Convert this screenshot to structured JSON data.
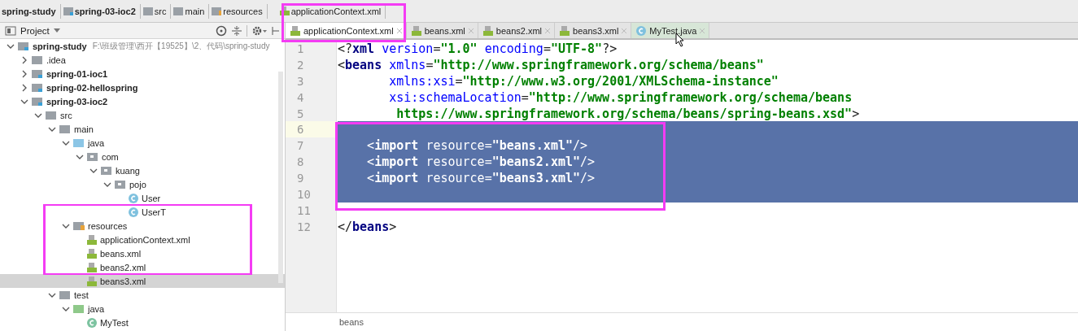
{
  "breadcrumbs": [
    {
      "label": "spring-study",
      "kind": "project"
    },
    {
      "label": "spring-03-ioc2",
      "kind": "module"
    },
    {
      "label": "src",
      "kind": "folder"
    },
    {
      "label": "main",
      "kind": "folder"
    },
    {
      "label": "resources",
      "kind": "resources"
    },
    {
      "label": "applicationContext.xml",
      "kind": "xml"
    }
  ],
  "project_panel": {
    "title": "Project",
    "tree": [
      {
        "label": "spring-study",
        "kind": "module",
        "path": "F:\\班级管理\\西开【19525】\\2、代码\\spring-study",
        "expanded": true,
        "selected": false,
        "children": [
          {
            "label": ".idea",
            "kind": "folder",
            "expanded": false,
            "selected": false
          },
          {
            "label": "spring-01-ioc1",
            "kind": "module",
            "expanded": false,
            "selected": false
          },
          {
            "label": "spring-02-hellospring",
            "kind": "module",
            "expanded": false,
            "selected": false
          },
          {
            "label": "spring-03-ioc2",
            "kind": "module",
            "expanded": true,
            "selected": false,
            "children": [
              {
                "label": "src",
                "kind": "folder",
                "expanded": true,
                "selected": false,
                "children": [
                  {
                    "label": "main",
                    "kind": "folder",
                    "expanded": true,
                    "selected": false,
                    "children": [
                      {
                        "label": "java",
                        "kind": "source",
                        "expanded": true,
                        "selected": false,
                        "children": [
                          {
                            "label": "com",
                            "kind": "package",
                            "expanded": true,
                            "selected": false,
                            "children": [
                              {
                                "label": "kuang",
                                "kind": "package",
                                "expanded": true,
                                "selected": false,
                                "children": [
                                  {
                                    "label": "pojo",
                                    "kind": "package",
                                    "expanded": true,
                                    "selected": false,
                                    "children": [
                                      {
                                        "label": "User",
                                        "kind": "class",
                                        "selected": false
                                      },
                                      {
                                        "label": "UserT",
                                        "kind": "class",
                                        "selected": false
                                      }
                                    ]
                                  }
                                ]
                              }
                            ]
                          }
                        ]
                      },
                      {
                        "label": "resources",
                        "kind": "resources",
                        "expanded": true,
                        "selected": false,
                        "children": [
                          {
                            "label": "applicationContext.xml",
                            "kind": "xml",
                            "selected": false
                          },
                          {
                            "label": "beans.xml",
                            "kind": "xml",
                            "selected": false
                          },
                          {
                            "label": "beans2.xml",
                            "kind": "xml",
                            "selected": false
                          },
                          {
                            "label": "beans3.xml",
                            "kind": "xml",
                            "selected": true
                          }
                        ]
                      }
                    ]
                  },
                  {
                    "label": "test",
                    "kind": "folder",
                    "expanded": true,
                    "selected": false,
                    "children": [
                      {
                        "label": "java",
                        "kind": "test",
                        "expanded": true,
                        "selected": false,
                        "children": [
                          {
                            "label": "MyTest",
                            "kind": "testclass",
                            "selected": false
                          }
                        ]
                      }
                    ]
                  }
                ]
              }
            ]
          }
        ]
      }
    ]
  },
  "tabs": [
    {
      "label": "applicationContext.xml",
      "kind": "xml",
      "selected": true
    },
    {
      "label": "beans.xml",
      "kind": "xml",
      "selected": false
    },
    {
      "label": "beans2.xml",
      "kind": "xml",
      "selected": false
    },
    {
      "label": "beans3.xml",
      "kind": "xml",
      "selected": false
    },
    {
      "label": "MyTest.java",
      "kind": "class",
      "selected": false
    }
  ],
  "editor": {
    "lines": [
      {
        "number": "1",
        "selected": false,
        "tokens": [
          {
            "kind": "punct",
            "text": "<?"
          },
          {
            "kind": "tag",
            "text": "xml "
          },
          {
            "kind": "attr",
            "text": "version"
          },
          {
            "kind": "punct",
            "text": "="
          },
          {
            "kind": "str",
            "text": "\"1.0\" "
          },
          {
            "kind": "attr",
            "text": "encoding"
          },
          {
            "kind": "punct",
            "text": "="
          },
          {
            "kind": "str",
            "text": "\"UTF-8\""
          },
          {
            "kind": "punct",
            "text": "?>"
          }
        ]
      },
      {
        "number": "2",
        "selected": false,
        "tokens": [
          {
            "kind": "punct",
            "text": "<"
          },
          {
            "kind": "tag",
            "text": "beans "
          },
          {
            "kind": "attr",
            "text": "xmlns"
          },
          {
            "kind": "punct",
            "text": "="
          },
          {
            "kind": "str",
            "text": "\"http://www.springframework.org/schema/beans\""
          }
        ]
      },
      {
        "number": "3",
        "selected": false,
        "tokens": [
          {
            "kind": "attr",
            "text": "       xmlns:xsi"
          },
          {
            "kind": "punct",
            "text": "="
          },
          {
            "kind": "str",
            "text": "\"http://www.w3.org/2001/XMLSchema-instance\""
          }
        ]
      },
      {
        "number": "4",
        "selected": false,
        "tokens": [
          {
            "kind": "attr",
            "text": "       xsi:schemaLocation"
          },
          {
            "kind": "punct",
            "text": "="
          },
          {
            "kind": "str",
            "text": "\"http://www.springframework.org/schema/beans"
          }
        ]
      },
      {
        "number": "5",
        "selected": false,
        "tokens": [
          {
            "kind": "str",
            "text": "        https://www.springframework.org/schema/beans/spring-beans.xsd\""
          },
          {
            "kind": "punct",
            "text": ">"
          }
        ]
      },
      {
        "number": "6",
        "selected": true
      },
      {
        "number": "7",
        "selected": true,
        "tokens": [
          {
            "kind": "punct",
            "text": "    <"
          },
          {
            "kind": "tag",
            "text": "import "
          },
          {
            "kind": "attr",
            "text": "resource"
          },
          {
            "kind": "punct",
            "text": "="
          },
          {
            "kind": "str",
            "text": "\"beans.xml\""
          },
          {
            "kind": "punct",
            "text": "/>"
          }
        ]
      },
      {
        "number": "8",
        "selected": true,
        "tokens": [
          {
            "kind": "punct",
            "text": "    <"
          },
          {
            "kind": "tag",
            "text": "import "
          },
          {
            "kind": "attr",
            "text": "resource"
          },
          {
            "kind": "punct",
            "text": "="
          },
          {
            "kind": "str",
            "text": "\"beans2.xml\""
          },
          {
            "kind": "punct",
            "text": "/>"
          }
        ]
      },
      {
        "number": "9",
        "selected": true,
        "tokens": [
          {
            "kind": "punct",
            "text": "    <"
          },
          {
            "kind": "tag",
            "text": "import "
          },
          {
            "kind": "attr",
            "text": "resource"
          },
          {
            "kind": "punct",
            "text": "="
          },
          {
            "kind": "str",
            "text": "\"beans3.xml\""
          },
          {
            "kind": "punct",
            "text": "/>"
          }
        ]
      },
      {
        "number": "10",
        "selected": true
      },
      {
        "number": "11",
        "selected": false
      },
      {
        "number": "12",
        "selected": false,
        "tokens": [
          {
            "kind": "punct",
            "text": "</"
          },
          {
            "kind": "tag",
            "text": "beans"
          },
          {
            "kind": "punct",
            "text": ">"
          }
        ]
      }
    ],
    "status_path": "beans"
  }
}
